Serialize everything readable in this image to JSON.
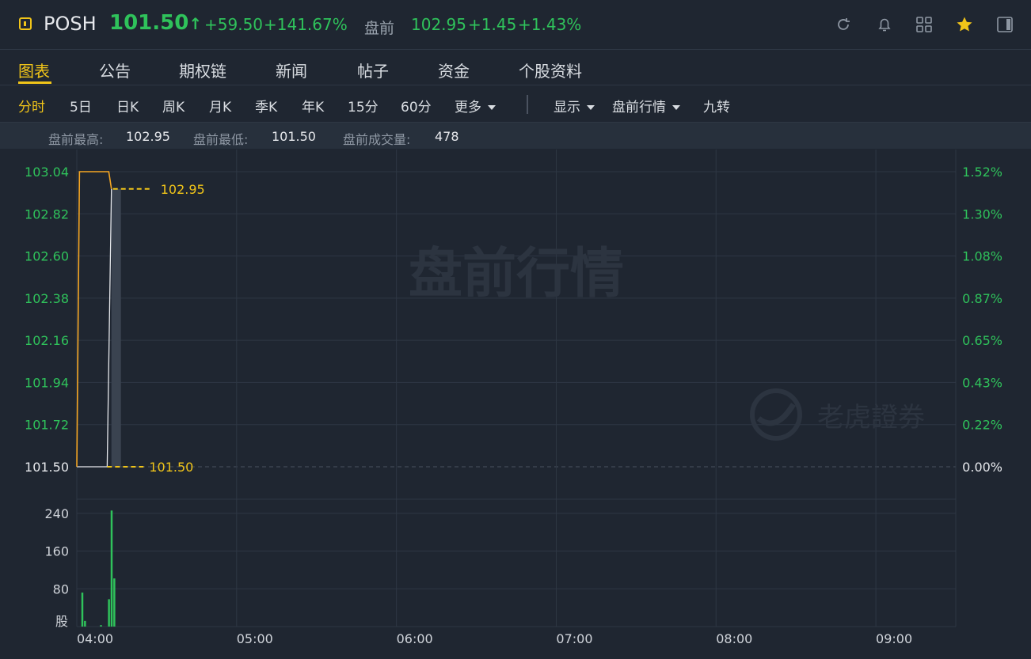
{
  "header": {
    "symbol": "POSH",
    "price": "101.50",
    "arrow": "↑",
    "change": "+59.50",
    "change_pct": "+141.67%",
    "premarket_label": "盘前",
    "premarket_price": "102.95",
    "premarket_change": "+1.45",
    "premarket_change_pct": "+1.43%",
    "icons": [
      "refresh-icon",
      "bell-icon",
      "grid-icon",
      "star-icon",
      "panel-icon"
    ]
  },
  "tabs": [
    {
      "label": "图表",
      "active": true
    },
    {
      "label": "公告"
    },
    {
      "label": "期权链"
    },
    {
      "label": "新闻"
    },
    {
      "label": "帖子"
    },
    {
      "label": "资金"
    },
    {
      "label": "个股资料"
    }
  ],
  "periods": [
    "分时",
    "5日",
    "日K",
    "周K",
    "月K",
    "季K",
    "年K",
    "15分",
    "60分",
    "更多"
  ],
  "toolbar": {
    "display_label": "显示",
    "session_label": "盘前行情",
    "nine_turn_label": "九转"
  },
  "stats": {
    "high_label": "盘前最高:",
    "high_value": "102.95",
    "low_label": "盘前最低:",
    "low_value": "101.50",
    "volume_label": "盘前成交量:",
    "volume_value": "478"
  },
  "watermark": {
    "session_text": "盘前行情",
    "brand_text": "老虎證券"
  },
  "colors": {
    "up": "#2fc25b",
    "accent": "#f0c419",
    "line": "#f5a623",
    "background": "#1f2631"
  },
  "chart_data": {
    "type": "line",
    "y_ticks_left": [
      "103.04",
      "102.82",
      "102.60",
      "102.38",
      "102.16",
      "101.94",
      "101.72",
      "101.50"
    ],
    "y_ticks_right": [
      "1.52%",
      "1.30%",
      "1.08%",
      "0.87%",
      "0.65%",
      "0.43%",
      "0.22%",
      "0.00%"
    ],
    "ylim": [
      101.5,
      103.04
    ],
    "x_ticks": [
      "04:00",
      "05:00",
      "06:00",
      "07:00",
      "08:00",
      "09:00"
    ],
    "price_series": {
      "x": [
        "04:00",
        "04:01",
        "04:12",
        "04:13"
      ],
      "values": [
        101.5,
        103.04,
        103.04,
        102.95
      ]
    },
    "last_price_label": "102.95",
    "base_price_label": "101.50",
    "volume": {
      "unit_label": "股",
      "y_ticks": [
        "240",
        "160",
        "80"
      ],
      "ylim": [
        0,
        270
      ],
      "bars": [
        {
          "x": "04:02",
          "value": 72
        },
        {
          "x": "04:03",
          "value": 12
        },
        {
          "x": "04:09",
          "value": 3
        },
        {
          "x": "04:12",
          "value": 58
        },
        {
          "x": "04:13",
          "value": 246
        },
        {
          "x": "04:14",
          "value": 102
        }
      ]
    }
  }
}
